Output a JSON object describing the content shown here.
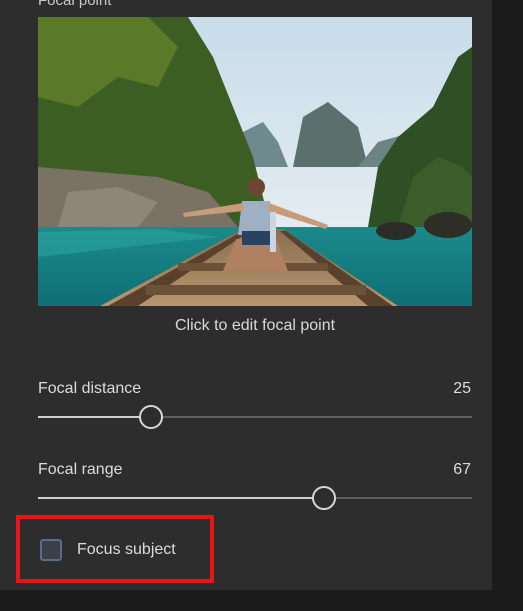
{
  "section": {
    "title": "Focal point"
  },
  "photo": {
    "caption": "Click to edit focal point"
  },
  "sliders": [
    {
      "label": "Focal distance",
      "value": "25",
      "fraction": 0.26
    },
    {
      "label": "Focal range",
      "value": "67",
      "fraction": 0.66
    }
  ],
  "checkbox": {
    "label": "Focus subject",
    "checked": false
  },
  "colors": {
    "panel": "#2d2d2d",
    "highlight": "#e8141a",
    "track": "#5d5d5d",
    "track_fill": "#cfcfcf"
  }
}
